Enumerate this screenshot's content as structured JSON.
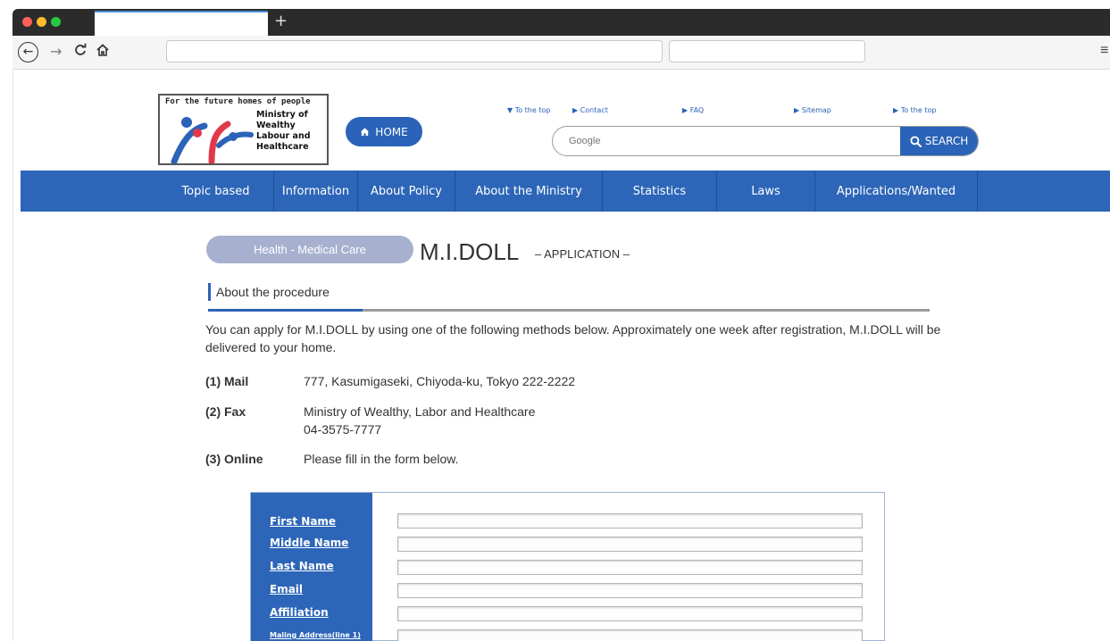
{
  "browser": {
    "back_icon": "←",
    "forward_icon": "→",
    "reload_icon": "C",
    "home_icon": "⌂",
    "newtab_icon": "+",
    "menu_icon": "≡",
    "url": "",
    "search": ""
  },
  "header": {
    "logo": {
      "tagline": "For the future homes of people",
      "name_lines": [
        "Ministry of",
        "Wealthy",
        "Labour and",
        "Healthcare"
      ]
    },
    "home_label": "HOME",
    "top_links": [
      "To the top",
      "Contact",
      "FAQ",
      "Sitemap",
      "To the top"
    ],
    "search_placeholder": "Google",
    "search_label": "SEARCH"
  },
  "nav": {
    "items": [
      "Topic based",
      "Information",
      "About Policy",
      "About the Ministry",
      "Statistics",
      "Laws",
      "Applications/Wanted"
    ]
  },
  "content": {
    "category": "Health - Medical Care",
    "title": "M.I.DOLL",
    "subtitle": "– APPLICATION –",
    "section_title": "About the procedure",
    "intro": "You can apply for M.I.DOLL by using one of the following methods below. Approximately one week after registration, M.I.DOLL will be delivered to your home.",
    "methods": [
      {
        "label": "(1) Mail",
        "lines": [
          "777, Kasumigaseki, Chiyoda-ku, Tokyo 222-2222"
        ]
      },
      {
        "label": "(2) Fax",
        "lines": [
          "Ministry of Wealthy, Labor and Healthcare",
          "04-3575-7777"
        ]
      },
      {
        "label": "(3) Online",
        "lines": [
          "Please fill in the form below."
        ]
      }
    ]
  },
  "form": {
    "fields": [
      {
        "label": "First Name",
        "value": ""
      },
      {
        "label": "Middle Name",
        "value": ""
      },
      {
        "label": "Last Name",
        "value": ""
      },
      {
        "label": "Email",
        "value": ""
      },
      {
        "label": "Affiliation",
        "value": ""
      },
      {
        "label": "Maling Address(line 1)",
        "value": ""
      }
    ]
  },
  "colors": {
    "brand_blue": "#2d66b8",
    "pill": "#a7b1cf"
  }
}
